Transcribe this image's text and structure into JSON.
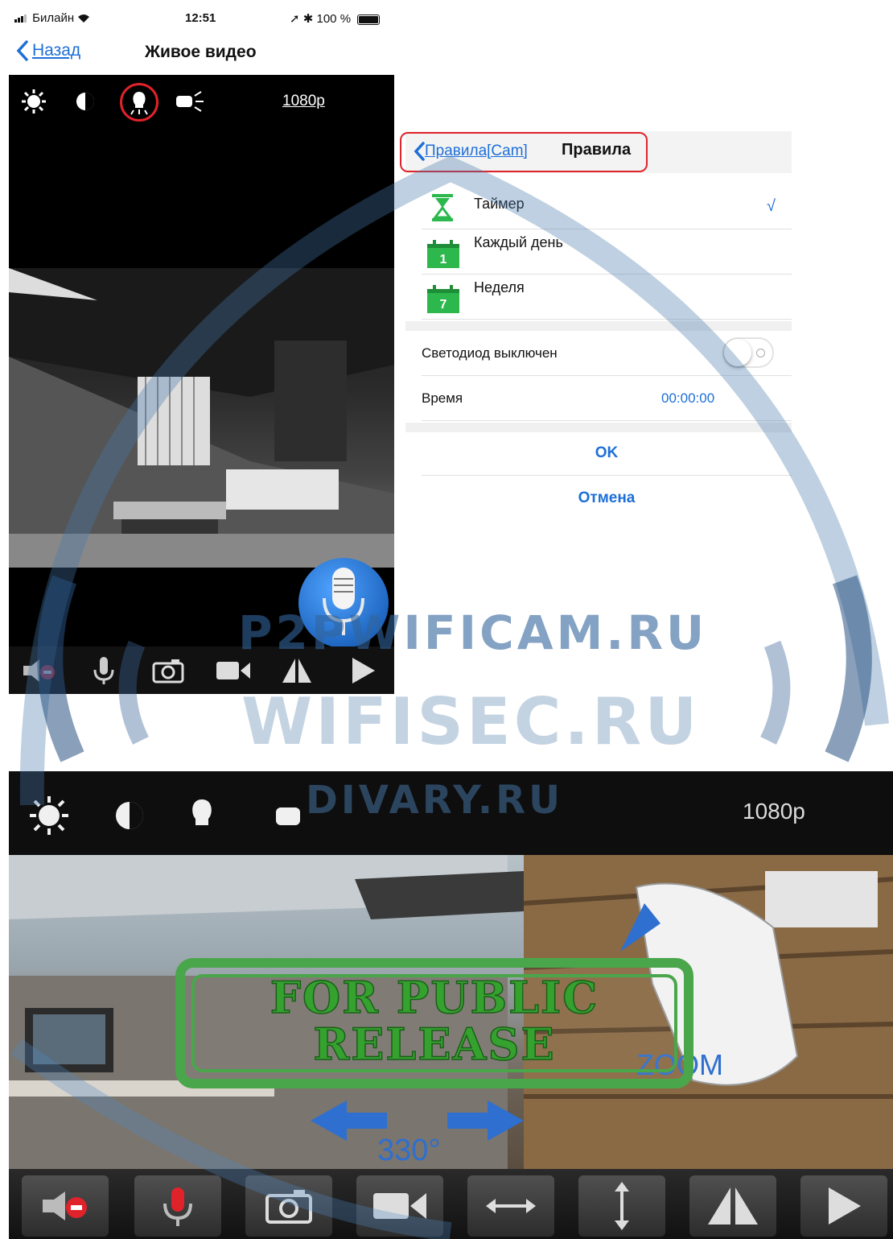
{
  "status": {
    "carrier": "Билайн",
    "time": "12:51",
    "battery": "100 %"
  },
  "nav": {
    "back_label": "Назад",
    "title": "Живое видео"
  },
  "video_top": {
    "resolution": "1080p"
  },
  "rules": {
    "back_label": "Правила[Cam]",
    "title": "Правила",
    "items": [
      {
        "label": "Таймер",
        "checked_mark": "√",
        "icon": "hourglass-icon"
      },
      {
        "label": "Каждый день",
        "icon_num": "1",
        "icon": "calendar-icon"
      },
      {
        "label": "Неделя",
        "icon_num": "7",
        "icon": "calendar-icon"
      }
    ],
    "led_label": "Светодиод выключен",
    "time_label": "Время",
    "time_value": "00:00:00",
    "ok_label": "OK",
    "cancel_label": "Отмена"
  },
  "video_bottom": {
    "resolution": "1080p",
    "zoom_label": "ZOOM",
    "angle_label": "330°"
  },
  "stamp": {
    "text": "FOR PUBLIC RELEASE"
  },
  "watermarks": [
    "P2PWIFICAM.RU",
    "WIFISEC.RU",
    "DIVARY.RU"
  ],
  "colors": {
    "accent": "#1d6fd8",
    "highlight": "#e0232b",
    "stamp": "#4aa64a",
    "calendar": "#2db84d"
  }
}
